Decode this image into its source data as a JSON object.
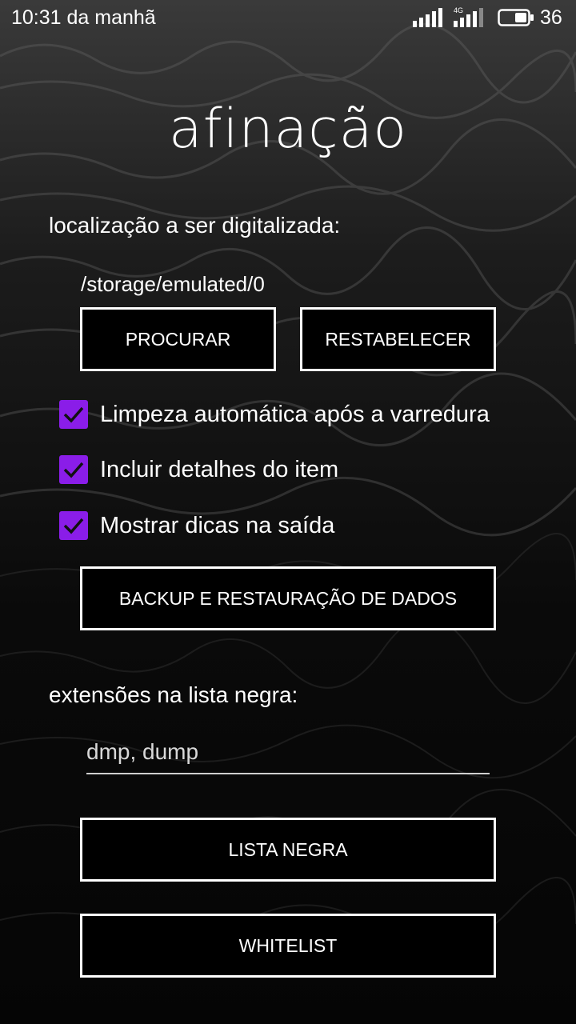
{
  "status_bar": {
    "time": "10:31 da manhã",
    "network_label": "4G",
    "battery_level": "36",
    "icons": [
      "signal-icon",
      "signal-4g-icon",
      "battery-icon"
    ]
  },
  "title": "afinação",
  "scan_location": {
    "label": "localização a ser digitalizada:",
    "path": "/storage/emulated/0",
    "browse_label": "PROCURAR",
    "reset_label": "RESTABELECER"
  },
  "options": [
    {
      "label": "Limpeza automática após a varredura",
      "checked": true
    },
    {
      "label": "Incluir detalhes do item",
      "checked": true
    },
    {
      "label": "Mostrar dicas na saída",
      "checked": true
    }
  ],
  "backup_label": "BACKUP E RESTAURAÇÃO DE DADOS",
  "blacklist": {
    "label": "extensões na lista negra:",
    "value": "dmp, dump",
    "blacklist_button": "LISTA NEGRA",
    "whitelist_button": "WHITELIST"
  },
  "colors": {
    "checkbox": "#8a1de8",
    "background": "#050505",
    "text": "#ffffff"
  }
}
